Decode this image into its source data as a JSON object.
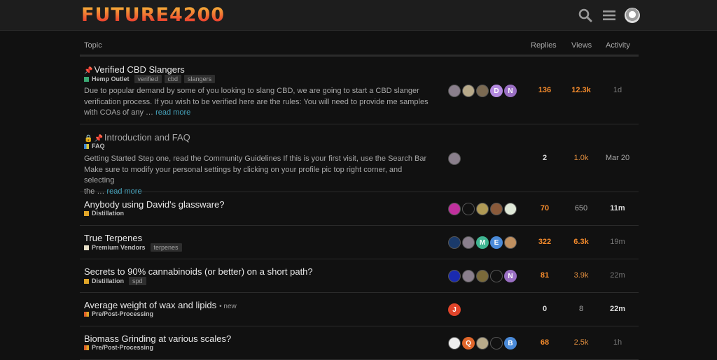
{
  "header": {
    "logo": "FUTURE4200",
    "icons": [
      "search-icon",
      "menu-icon",
      "user-avatar"
    ]
  },
  "columns": {
    "topic": "Topic",
    "replies": "Replies",
    "views": "Views",
    "activity": "Activity"
  },
  "topics": [
    {
      "title": "Verified CBD Slangers",
      "pinned": true,
      "locked": false,
      "category": "Hemp Outlet",
      "category_color": [
        "#3aa872",
        "#3aa872"
      ],
      "tags": [
        "verified",
        "cbd",
        "slangers"
      ],
      "excerpt_lines": [
        "Due to popular demand by some of you looking to slang CBD, we are going to start a CBD slanger",
        "verification process. If you wish to be verified here are the rules: You will need to provide me samples",
        "with COAs of any …"
      ],
      "read_more": "read more",
      "posters": [
        {
          "letter": "",
          "color": "#8a7f8c"
        },
        {
          "letter": "",
          "color": "#b8aa8a"
        },
        {
          "letter": "",
          "color": "#7b6a52"
        },
        {
          "letter": "D",
          "color": "#b48ae0"
        },
        {
          "letter": "N",
          "color": "#9a6fc3"
        }
      ],
      "replies": "136",
      "views": "12.3k",
      "activity": "1d"
    },
    {
      "title": "Introduction and FAQ",
      "pinned": true,
      "locked": true,
      "category": "FAQ",
      "category_color": [
        "#3b85d8",
        "#d8c63b"
      ],
      "tags": [],
      "excerpt_lines": [
        "Getting Started Step one, read the Community Guidelines If this is your first visit, use the Search Bar",
        "Make sure to modify your personal settings by clicking on your profile pic top right corner, and selecting",
        "the …"
      ],
      "read_more": "read more",
      "posters": [
        {
          "letter": "",
          "color": "#8a7f8c"
        }
      ],
      "replies": "2",
      "views": "1.0k",
      "activity": "Mar 20"
    },
    {
      "title": "Anybody using David's glassware?",
      "pinned": false,
      "locked": false,
      "category": "Distillation",
      "category_color": [
        "#e0a528",
        "#e0a528"
      ],
      "tags": [],
      "posters": [
        {
          "letter": "",
          "color": "#c0309e"
        },
        {
          "letter": "",
          "color": "#111111"
        },
        {
          "letter": "",
          "color": "#b09a55"
        },
        {
          "letter": "",
          "color": "#8a5a3a"
        },
        {
          "letter": "",
          "color": "#dfe8d8"
        }
      ],
      "replies": "70",
      "views": "650",
      "activity": "11m"
    },
    {
      "title": "True Terpenes",
      "pinned": false,
      "locked": false,
      "category": "Premium Vendors",
      "category_color": [
        "#e8e0c8",
        "#e8e0c8"
      ],
      "tags": [
        "terpenes"
      ],
      "posters": [
        {
          "letter": "",
          "color": "#1a3a6a"
        },
        {
          "letter": "",
          "color": "#8a7f8c"
        },
        {
          "letter": "M",
          "color": "#3fb591"
        },
        {
          "letter": "E",
          "color": "#4a8ad8"
        },
        {
          "letter": "",
          "color": "#c09060"
        }
      ],
      "replies": "322",
      "views": "6.3k",
      "activity": "19m"
    },
    {
      "title": "Secrets to 90% cannabinoids (or better) on a short path?",
      "pinned": false,
      "locked": false,
      "category": "Distillation",
      "category_color": [
        "#e0a528",
        "#e0a528"
      ],
      "tags": [
        "spd"
      ],
      "posters": [
        {
          "letter": "",
          "color": "#1a2ab0"
        },
        {
          "letter": "",
          "color": "#8a7f8c"
        },
        {
          "letter": "",
          "color": "#7a6a3a"
        },
        {
          "letter": "",
          "color": "#111111"
        },
        {
          "letter": "N",
          "color": "#9a6fc3"
        }
      ],
      "replies": "81",
      "views": "3.9k",
      "activity": "22m"
    },
    {
      "title": "Average weight of wax and lipids",
      "pinned": false,
      "locked": false,
      "is_new": true,
      "new_label": "new",
      "category": "Pre/Post-Processing",
      "category_color": [
        "#e0602a",
        "#e0a528"
      ],
      "tags": [],
      "posters": [
        {
          "letter": "J",
          "color": "#e0442a"
        }
      ],
      "replies": "0",
      "views": "8",
      "activity": "22m"
    },
    {
      "title": "Biomass Grinding at various scales?",
      "pinned": false,
      "locked": false,
      "category": "Pre/Post-Processing",
      "category_color": [
        "#e0602a",
        "#e0a528"
      ],
      "tags": [],
      "posters": [
        {
          "letter": "",
          "color": "#ededed"
        },
        {
          "letter": "Q",
          "color": "#e0662a"
        },
        {
          "letter": "",
          "color": "#b8aa8a"
        },
        {
          "letter": "",
          "color": "#111111"
        },
        {
          "letter": "B",
          "color": "#4a8ad8"
        }
      ],
      "replies": "68",
      "views": "2.5k",
      "activity": "1h"
    }
  ]
}
